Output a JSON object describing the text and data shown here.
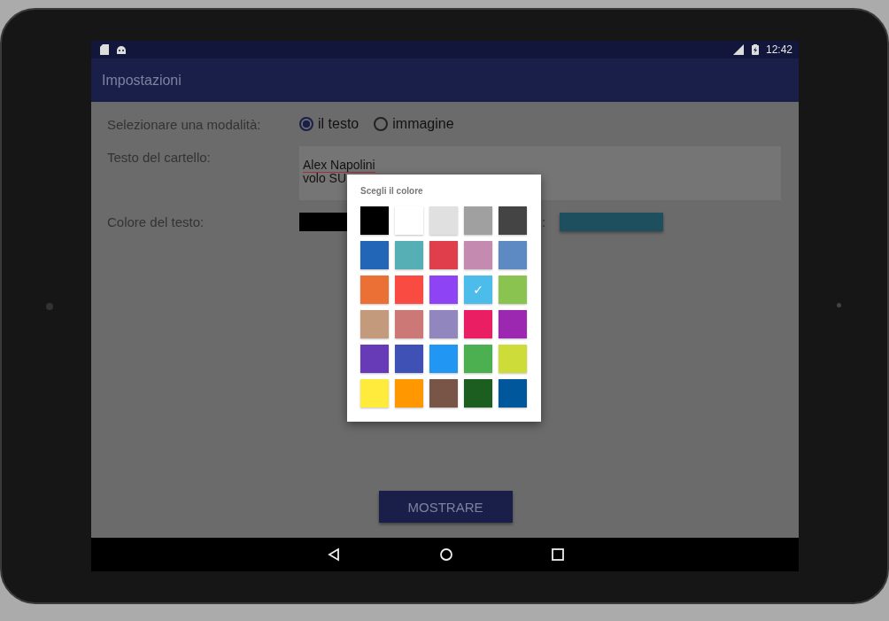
{
  "status_bar": {
    "time": "12:42"
  },
  "app_bar": {
    "title": "Impostazioni"
  },
  "form": {
    "mode_label": "Selezionare una modalità:",
    "modes": [
      {
        "label": "il testo",
        "selected": true
      },
      {
        "label": "immagine",
        "selected": false
      }
    ],
    "sign_text_label": "Testo del cartello:",
    "sign_text_lines": [
      "Alex Napolini",
      "volo SU"
    ],
    "text_color_label": "Colore del testo:",
    "hidden_label_tail": ":"
  },
  "show_button": "MOSTRARE",
  "color_dialog": {
    "title": "Scegli il colore",
    "check_glyph": "✓",
    "swatches": [
      {
        "color": "#000000",
        "selected": false
      },
      {
        "color": "#ffffff",
        "selected": false
      },
      {
        "color": "#e0e0e0",
        "selected": false
      },
      {
        "color": "#a0a0a0",
        "selected": false
      },
      {
        "color": "#444444",
        "selected": false
      },
      {
        "color": "#2266b8",
        "selected": false
      },
      {
        "color": "#56afb5",
        "selected": false
      },
      {
        "color": "#e03e4a",
        "selected": false
      },
      {
        "color": "#c48ab0",
        "selected": false
      },
      {
        "color": "#5e8ac4",
        "selected": false
      },
      {
        "color": "#ea7035",
        "selected": false
      },
      {
        "color": "#fa4b42",
        "selected": false
      },
      {
        "color": "#8e44f5",
        "selected": false
      },
      {
        "color": "#4cbcea",
        "selected": true
      },
      {
        "color": "#8bc350",
        "selected": false
      },
      {
        "color": "#c49a7c",
        "selected": false
      },
      {
        "color": "#cc7876",
        "selected": false
      },
      {
        "color": "#9186be",
        "selected": false
      },
      {
        "color": "#e91e63",
        "selected": false
      },
      {
        "color": "#9c27b0",
        "selected": false
      },
      {
        "color": "#673ab7",
        "selected": false
      },
      {
        "color": "#3f51b5",
        "selected": false
      },
      {
        "color": "#2196f3",
        "selected": false
      },
      {
        "color": "#4caf50",
        "selected": false
      },
      {
        "color": "#cddc39",
        "selected": false
      },
      {
        "color": "#ffeb3b",
        "selected": false
      },
      {
        "color": "#ff9800",
        "selected": false
      },
      {
        "color": "#795548",
        "selected": false
      },
      {
        "color": "#1b5e20",
        "selected": false
      },
      {
        "color": "#01579b",
        "selected": false
      }
    ]
  }
}
